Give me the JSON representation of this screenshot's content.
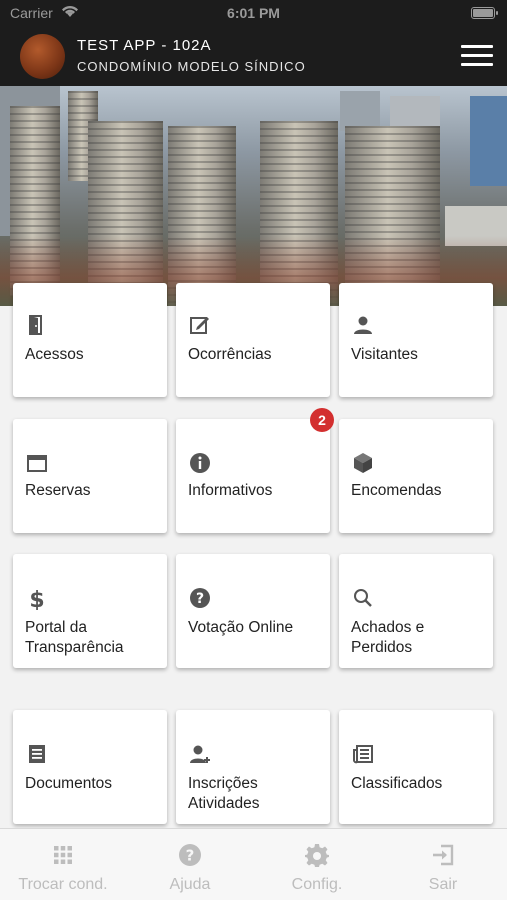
{
  "status_bar": {
    "carrier": "Carrier",
    "time": "6:01 PM"
  },
  "header": {
    "title": "TEST APP - 102A",
    "subtitle": "CONDOMÍNIO MODELO SÍNDICO"
  },
  "tiles": [
    {
      "label": "Acessos",
      "icon": "door-icon"
    },
    {
      "label": "Ocorrências",
      "icon": "edit-note-icon"
    },
    {
      "label": "Visitantes",
      "icon": "person-icon"
    },
    {
      "label": "Reservas",
      "icon": "calendar-icon"
    },
    {
      "label": "Informativos",
      "icon": "info-icon",
      "badge": "2"
    },
    {
      "label": "Encomendas",
      "icon": "package-icon"
    },
    {
      "label": "Portal da Transparência",
      "icon": "dollar-icon"
    },
    {
      "label": "Votação Online",
      "icon": "help-icon"
    },
    {
      "label": "Achados e Perdidos",
      "icon": "search-icon"
    },
    {
      "label": "Documentos",
      "icon": "document-icon"
    },
    {
      "label": "Inscrições Atividades",
      "icon": "person-add-icon"
    },
    {
      "label": "Classificados",
      "icon": "newspaper-icon"
    }
  ],
  "tab_bar": [
    {
      "label": "Trocar cond.",
      "icon": "grid-icon"
    },
    {
      "label": "Ajuda",
      "icon": "help-circle-icon"
    },
    {
      "label": "Config.",
      "icon": "gear-icon"
    },
    {
      "label": "Sair",
      "icon": "logout-icon"
    }
  ],
  "colors": {
    "header_bg": "#1c1c1c",
    "badge": "#d32f2f",
    "tab_inactive": "#bdbdbd"
  }
}
